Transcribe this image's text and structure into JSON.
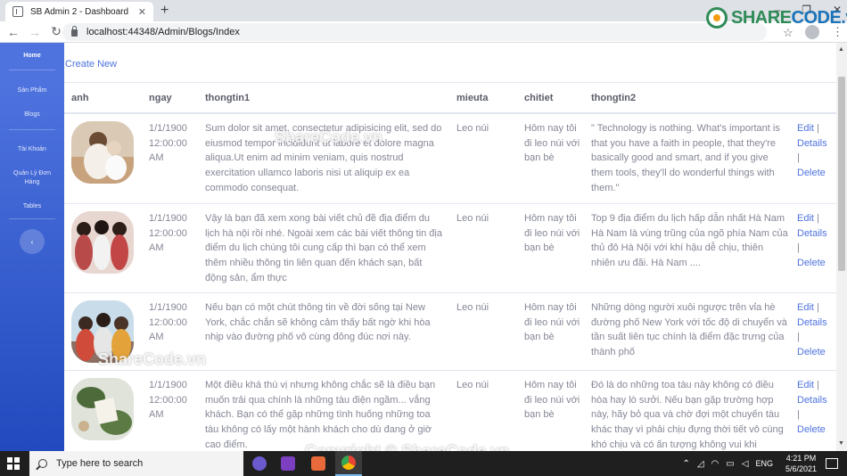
{
  "browser": {
    "tab_title": "SB Admin 2 - Dashboard",
    "tab_close": "✕",
    "new_tab": "+",
    "url": "localhost:44348/Admin/Blogs/Index"
  },
  "watermark": {
    "logo_part1": "SHARE",
    "logo_part2": "CODE.vn",
    "overlay1": "ShareCode.vn",
    "overlay2": "ShareCode.vn",
    "overlay3": "Copyright © ShareCode.vn"
  },
  "sidebar": {
    "items": [
      {
        "label": "Home",
        "active": true
      },
      {
        "label": "Sản Phẩm"
      },
      {
        "label": "Blogs"
      },
      {
        "label": "Tài Khoản"
      },
      {
        "label": "Quản Lý Đơn Hàng"
      },
      {
        "label": "Tables"
      }
    ]
  },
  "page": {
    "create_link": "Create New"
  },
  "table": {
    "headers": [
      "anh",
      "ngay",
      "thongtin1",
      "mieuta",
      "chitiet",
      "thongtin2"
    ],
    "rows": [
      {
        "date": "1/1/1900 12:00:00 AM",
        "thongtin1": "Sum dolor sit amet, consectetur adipisicing elit, sed do eiusmod tempor incididunt ut labore et dolore magna aliqua.Ut enim ad minim veniam, quis nostrud exercitation ullamco laboris nisi ut aliquip ex ea commodo consequat.",
        "mieuta": "Leo núi",
        "chitiet": "Hôm nay tôi đi leo núi với bạn bè",
        "thongtin2": "\" Technology is nothing. What's important is that you have a faith in people, that they're basically good and smart, and if you give them tools, they'll do wonderful things with them.\""
      },
      {
        "date": "1/1/1900 12:00:00 AM",
        "thongtin1": "Vậy là bạn đã xem xong bài viết chủ đề địa điểm du lịch hà nội rồi nhé. Ngoài xem các bài viết thông tin địa điểm du lịch chúng tôi cung cấp thì bạn có thể xem thêm nhiều thông tin liên quan đến khách sạn, bất động sản, ẩm thực",
        "mieuta": "Leo núi",
        "chitiet": "Hôm nay tôi đi leo núi với bạn bè",
        "thongtin2": "Top 9 địa điểm du lịch hấp dẫn nhất Hà Nam Hà Nam là vùng trũng của ngõ phía Nam của thủ đô Hà Nội với khí hậu dễ chịu, thiên nhiên ưu đãi. Hà Nam ...."
      },
      {
        "date": "1/1/1900 12:00:00 AM",
        "thongtin1": "Nếu bạn có một chút thông tin về đời sống tại New York, chắc chắn sẽ không cảm thấy bất ngờ khi hòa nhịp vào đường phố vô cùng đông đúc nơi này.",
        "mieuta": "Leo núi",
        "chitiet": "Hôm nay tôi đi leo núi với bạn bè",
        "thongtin2": "Những dòng người xuôi ngược trên vỉa hè đường phố New York với tốc độ di chuyển và tần suất liên tục chính là điểm đặc trưng của thành phố"
      },
      {
        "date": "1/1/1900 12:00:00 AM",
        "thongtin1": "Một điều khá thú vị nhưng không chắc sẽ là điều bạn muốn trải qua chính là những tàu điện ngầm... vắng khách. Bạn có thể gặp những tình huống những toa tàu không có lấy một hành khách cho dù đang ở giờ cao điểm.",
        "mieuta": "Leo núi",
        "chitiet": "Hôm nay tôi đi leo núi với bạn bè",
        "thongtin2": "Đó là do những toa tàu này không có điều hòa hay lò sưởi. Nếu bạn gặp trường hợp này, hãy bỏ qua và chờ đợi một chuyến tàu khác thay vì phải chịu đựng thời tiết vô cùng khó chịu và có ấn tượng không vui khi"
      }
    ],
    "actions": {
      "edit": "Edit",
      "sep": "|",
      "details": "Details",
      "delete": "Delete"
    }
  },
  "taskbar": {
    "search_placeholder": "Type here to search",
    "language": "ENG",
    "time": "4:21 PM",
    "date": "5/6/2021"
  }
}
